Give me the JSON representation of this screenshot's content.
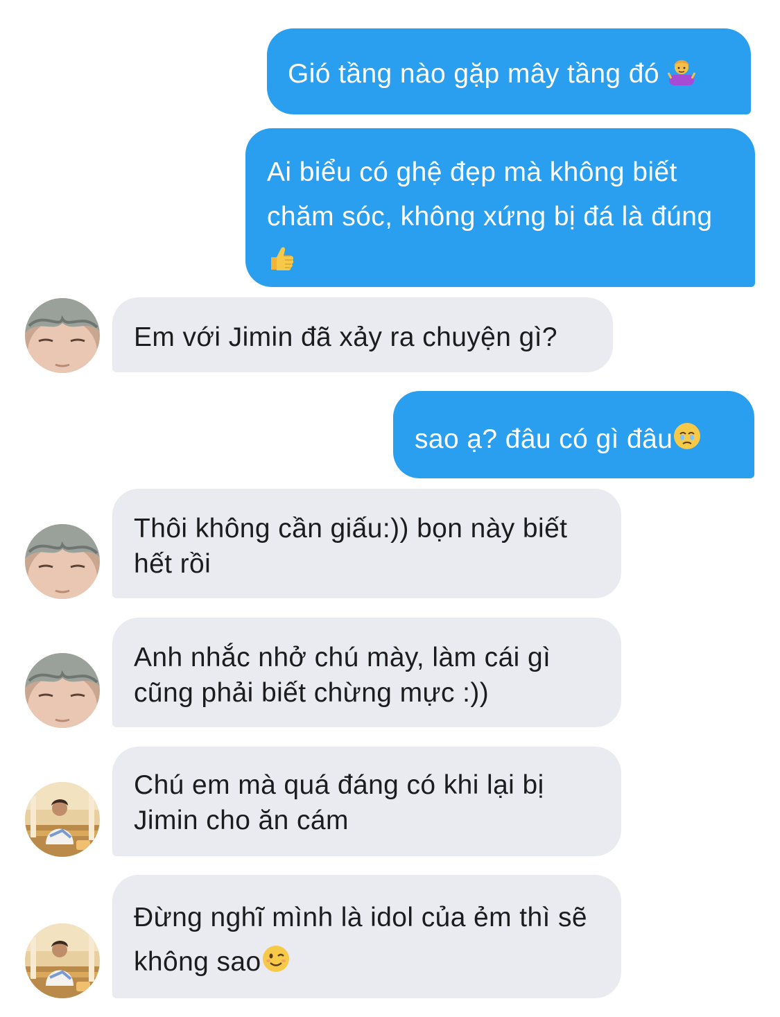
{
  "colors": {
    "outgoing_bubble": "#2a9ff0",
    "incoming_bubble": "#e9ebf0",
    "outgoing_text": "#ffffff",
    "incoming_text": "#1c1c1e"
  },
  "messages": [
    {
      "direction": "outgoing",
      "text": "Gió tầng nào gặp mây tầng đó",
      "emoji_icon": "woman-shrugging-emoji"
    },
    {
      "direction": "outgoing",
      "text": "Ai biểu có ghệ đẹp mà không biết chăm sóc, không xứng bị đá là đúng",
      "emoji_icon": "thumbs-up-emoji"
    },
    {
      "direction": "incoming",
      "sender_avatar": "avatar-grey-hair",
      "text": "Em với Jimin đã xảy ra chuyện gì?"
    },
    {
      "direction": "outgoing",
      "text": "sao ạ? đâu có gì đâu",
      "emoji_icon": "holding-back-tears-emoji"
    },
    {
      "direction": "incoming",
      "sender_avatar": "avatar-grey-hair",
      "text": "Thôi không cần giấu:)) bọn này biết hết rồi"
    },
    {
      "direction": "incoming",
      "sender_avatar": "avatar-grey-hair",
      "text": "Anh nhắc nhở chú mày, làm cái gì cũng phải biết chừng mực :))"
    },
    {
      "direction": "incoming",
      "sender_avatar": "avatar-sunset-photo",
      "text": "Chú em mà quá đáng có khi lại bị Jimin cho ăn cám"
    },
    {
      "direction": "incoming",
      "sender_avatar": "avatar-sunset-photo",
      "text": "Đừng nghĩ mình là idol của ẻm thì sẽ không sao",
      "emoji_icon": "winking-face-emoji"
    }
  ]
}
